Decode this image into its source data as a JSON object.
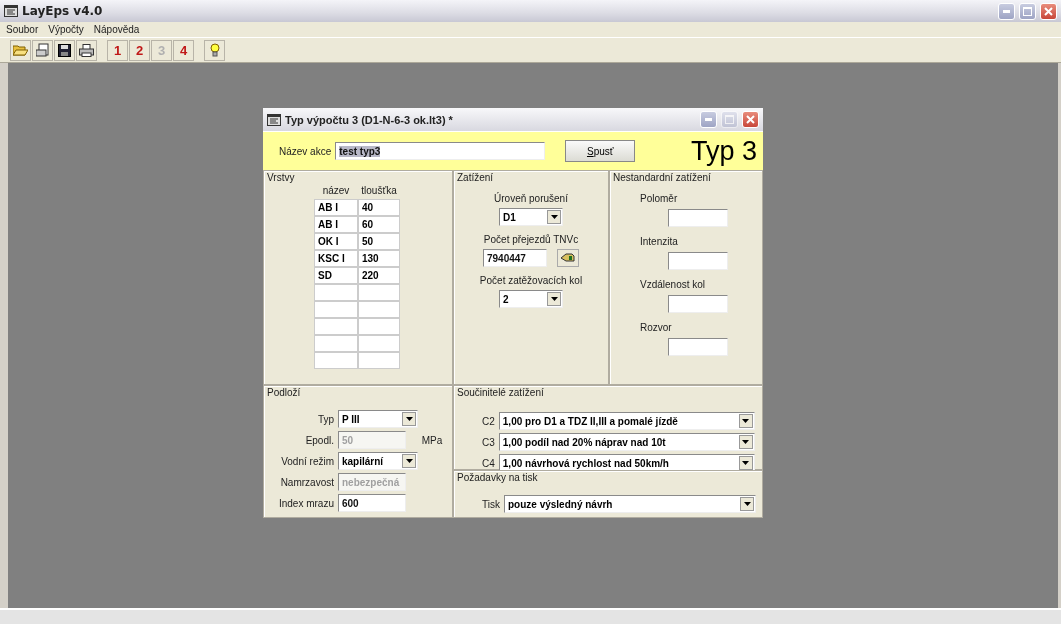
{
  "window": {
    "title": "LayEps v4.0"
  },
  "menu": [
    "Soubor",
    "Výpočty",
    "Nápověda"
  ],
  "toolbar": {
    "number_buttons": [
      {
        "label": "1",
        "disabled": false
      },
      {
        "label": "2",
        "disabled": false
      },
      {
        "label": "3",
        "disabled": true
      },
      {
        "label": "4",
        "disabled": false
      }
    ]
  },
  "dialog": {
    "title": "Typ výpočtu 3 (D1-N-6-3 ok.lt3) *",
    "window_controls": [
      {
        "kind": "minimize",
        "disabled": false
      },
      {
        "kind": "maximize",
        "disabled": true
      },
      {
        "kind": "close",
        "disabled": false
      }
    ],
    "header": {
      "label": "Název akce",
      "value": "test typ3",
      "text_selected": true,
      "button": "Spusť",
      "type_label": "Typ 3"
    },
    "layers": {
      "title": "Vrstvy",
      "columns": [
        "název",
        "tloušťka"
      ],
      "rows": [
        [
          "AB I",
          "40"
        ],
        [
          "AB I",
          "60"
        ],
        [
          "OK I",
          "50"
        ],
        [
          "KSC I",
          "130"
        ],
        [
          "SD",
          "220"
        ]
      ]
    },
    "loading": {
      "title": "Zatížení",
      "fields": [
        {
          "kind": "dropdown",
          "label": "Úroveň porušení",
          "value": "D1"
        },
        {
          "kind": "input_with_button",
          "label": "Počet přejezdů TNVc",
          "value": "7940447"
        },
        {
          "kind": "dropdown",
          "label": "Počet zatěžovacích kol",
          "value": "2"
        }
      ]
    },
    "nonstandard": {
      "title": "Nestandardní zatížení",
      "fields": [
        {
          "label": "Poloměr"
        },
        {
          "label": "Intenzita"
        },
        {
          "label": "Vzdálenost kol"
        },
        {
          "label": "Rozvor"
        }
      ]
    },
    "subgrade": {
      "title": "Podloží",
      "fields": [
        {
          "kind": "dropdown",
          "label": "Typ",
          "value": "P III"
        },
        {
          "kind": "input",
          "label": "Epodl.",
          "value": "50",
          "unit": "MPa",
          "disabled": true
        },
        {
          "kind": "dropdown",
          "label": "Vodní režim",
          "value": "kapilární"
        },
        {
          "kind": "input",
          "label": "Namrzavost",
          "value": "nebezpečná",
          "disabled": true
        },
        {
          "kind": "input",
          "label": "Index mrazu",
          "value": "600",
          "disabled": false
        }
      ]
    },
    "coefficients": {
      "title": "Součinitelé zatížení",
      "rows": [
        {
          "label": "C2",
          "value": "1,00 pro D1 a TDZ II,III a pomalé jízdě"
        },
        {
          "label": "C3",
          "value": "1,00 podíl nad 20% náprav nad 10t"
        },
        {
          "label": "C4",
          "value": "1,00 návrhová rychlost nad 50km/h"
        }
      ]
    },
    "print": {
      "title": "Požadavky na tisk",
      "fields": [
        {
          "label": "Tisk",
          "value": "pouze výsledný návrh"
        }
      ]
    }
  }
}
